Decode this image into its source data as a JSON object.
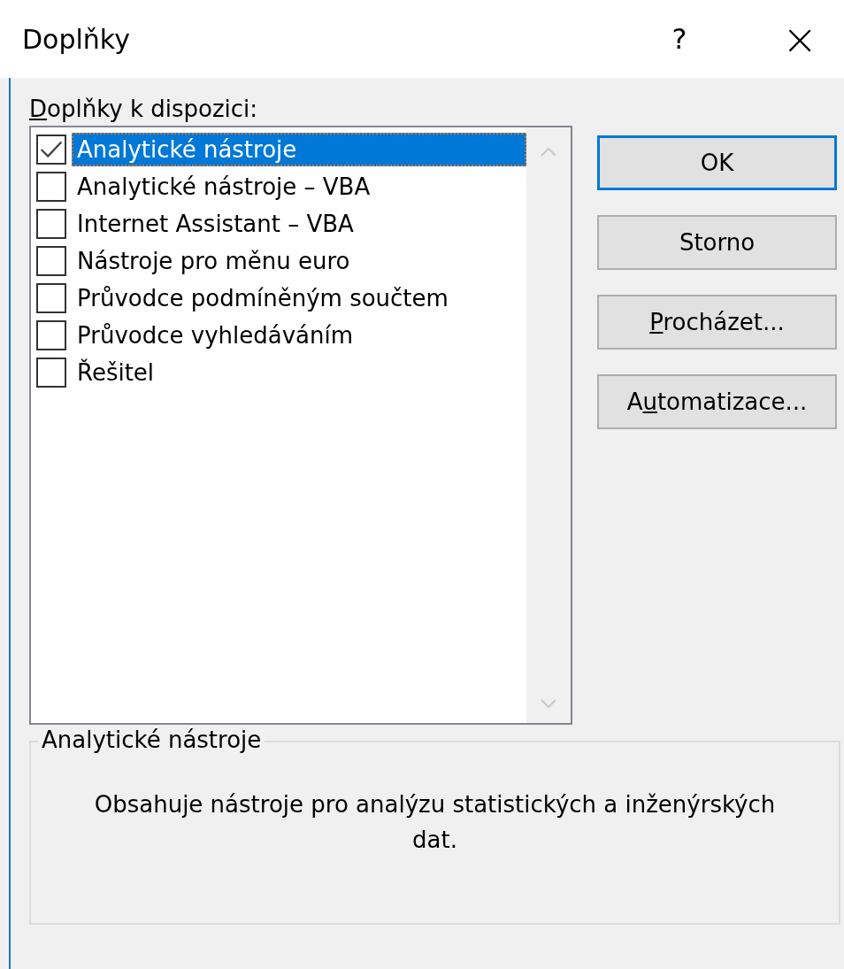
{
  "window": {
    "title": "Doplňky",
    "help": "?",
    "close": "×"
  },
  "list_label": {
    "key": "D",
    "post": "oplňky k dispozici:"
  },
  "addins": [
    {
      "label": "Analytické nástroje",
      "checked": true,
      "selected": true
    },
    {
      "label": "Analytické nástroje – VBA",
      "checked": false,
      "selected": false
    },
    {
      "label": "Internet Assistant – VBA",
      "checked": false,
      "selected": false
    },
    {
      "label": "Nástroje pro měnu euro",
      "checked": false,
      "selected": false
    },
    {
      "label": "Průvodce podmíněným součtem",
      "checked": false,
      "selected": false
    },
    {
      "label": "Průvodce vyhledáváním",
      "checked": false,
      "selected": false
    },
    {
      "label": "Řešitel",
      "checked": false,
      "selected": false
    }
  ],
  "buttons": [
    {
      "pre": "OK",
      "default": true
    },
    {
      "pre": "Storno",
      "default": false
    },
    {
      "key": "P",
      "post": "rocházet...",
      "default": false
    },
    {
      "pre": "A",
      "key": "u",
      "post": "tomatizace...",
      "default": false
    }
  ],
  "details": {
    "title": "Analytické nástroje",
    "description": "Obsahuje nástroje pro analýzu statistických a inženýrských dat."
  }
}
